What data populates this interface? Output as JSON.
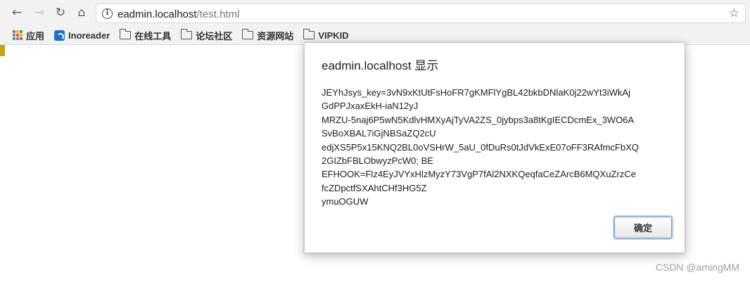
{
  "browser": {
    "nav": {
      "back_icon": "←",
      "forward_icon": "→",
      "reload_icon": "↻",
      "home_icon": "⌂"
    },
    "address_bar": {
      "host": "eadmin.localhost",
      "path": "/test.html",
      "info_icon": "i",
      "bookmark_star_icon": "☆"
    },
    "bookmarks": [
      {
        "label": "应用",
        "icon": "apps-grid-icon"
      },
      {
        "label": "Inoreader",
        "icon": "inoreader-icon"
      },
      {
        "label": "在线工具",
        "icon": "folder-icon"
      },
      {
        "label": "论坛社区",
        "icon": "folder-icon"
      },
      {
        "label": "资源网站",
        "icon": "folder-icon"
      },
      {
        "label": "VIPKID",
        "icon": "folder-icon"
      }
    ]
  },
  "dialog": {
    "title": "eadmin.localhost 显示",
    "message_lines": [
      "JEYhJsys_key=3vN9xKtUtFsHoFR7gKMFlYgBL42bkbDNlaK0j22wYt3iWkAj",
      "GdPPJxaxEkH-iaN12yJ",
      "MRZU-5naj6P5wN5KdlvHMXyAjTyVA2ZS_0jybps3a8tKgIECDcmEx_3WO6A",
      "SvBoXBAL7iGjNBSaZQ2cU",
      "edjXS5P5x15KNQ2BL0oVSHrW_5aU_0fDuRs0tJdVkExE07oFF3RAfmcFbXQ",
      "2GIZbFBLObwyzPcW0; BE",
      "EFHOOK=Flz4EyJVYxHlzMyzY73VgP7fAl2NXKQeqfaCeZArcB6MQXuZrzCe",
      "fcZDpctfSXAhtCHf3HG5Z",
      "ymuOGUW"
    ],
    "ok_label": "确定"
  },
  "watermark": "CSDN @amingMM",
  "colors": {
    "chrome_bg": "#f2f2f2",
    "focus_ring": "#6c94d6",
    "apps_grid": [
      "#e8453c",
      "#f4b400",
      "#34a853",
      "#4285f4",
      "#e8453c",
      "#f4b400",
      "#34a853",
      "#4285f4",
      "#e8453c"
    ]
  }
}
